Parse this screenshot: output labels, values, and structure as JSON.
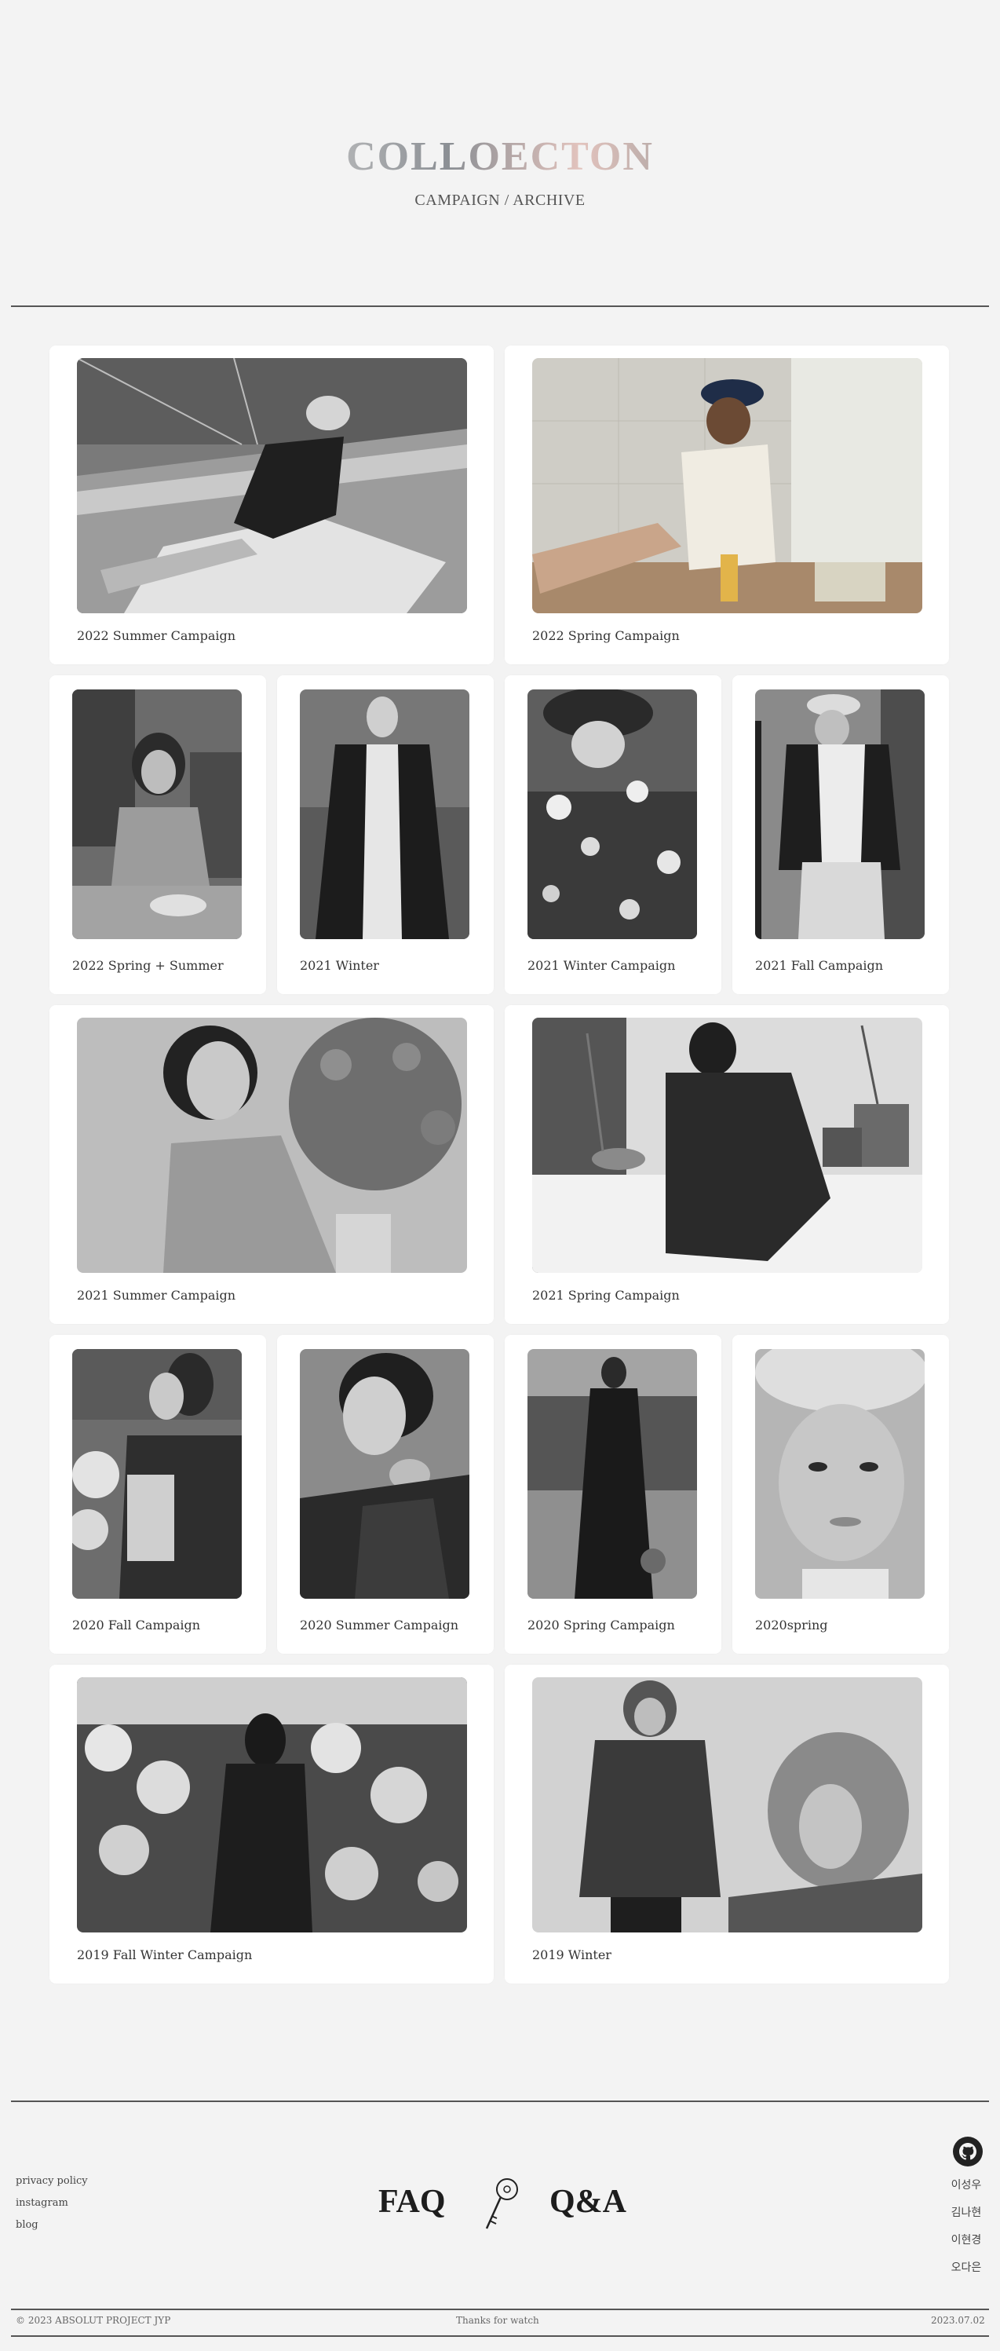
{
  "header": {
    "logo": "COLLOECTON",
    "subtitle": "CAMPAIGN / ARCHIVE"
  },
  "collections": [
    {
      "label": "2022 Summer Campaign",
      "icon": "sailboat-photo"
    },
    {
      "label": "2022 Spring Campaign",
      "icon": "kitchen-photo"
    },
    {
      "label": "2022 Spring + Summer",
      "icon": "cafe-photo"
    },
    {
      "label": "2021 Winter",
      "icon": "coat-photo"
    },
    {
      "label": "2021 Winter Campaign",
      "icon": "flowers-hat-photo"
    },
    {
      "label": "2021 Fall Campaign",
      "icon": "drink-photo"
    },
    {
      "label": "2021 Summer Campaign",
      "icon": "bouquet-photo"
    },
    {
      "label": "2021 Spring Campaign",
      "icon": "plants-photo"
    },
    {
      "label": "2020 Fall Campaign",
      "icon": "book-photo"
    },
    {
      "label": "2020 Summer Campaign",
      "icon": "portrait-photo"
    },
    {
      "label": "2020 Spring Campaign",
      "icon": "lake-photo"
    },
    {
      "label": "2020spring",
      "icon": "beret-photo"
    },
    {
      "label": "2019 Fall Winter Campaign",
      "icon": "flower-market-photo"
    },
    {
      "label": "2019 Winter",
      "icon": "parka-photo"
    }
  ],
  "footer": {
    "links": [
      "privacy policy",
      "instagram",
      "blog"
    ],
    "faq_label": "FAQ",
    "qa_label": "Q&A",
    "names": [
      "이성우",
      "김나현",
      "이현경",
      "오다은"
    ],
    "copyright": "© 2023 ABSOLUT PROJECT JYP",
    "thanks": "Thanks for watch",
    "date": "2023.07.02"
  }
}
